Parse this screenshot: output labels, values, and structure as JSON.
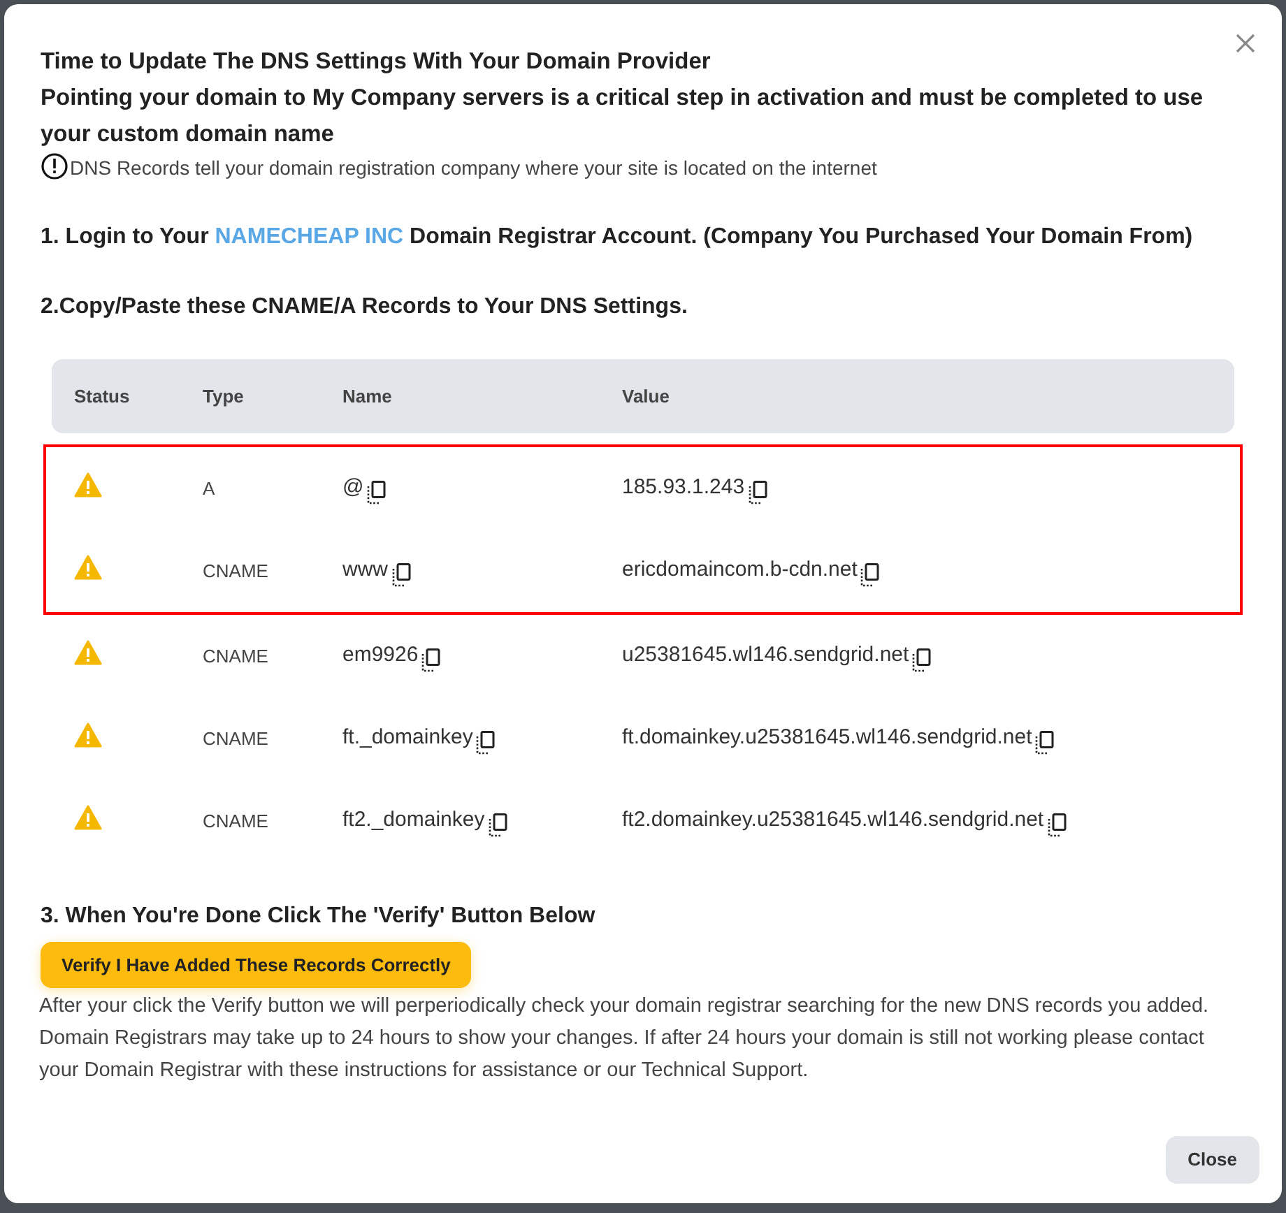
{
  "dialog": {
    "title": "Time to Update The DNS Settings With Your Domain Provider",
    "subtitle": "Pointing your domain to My Company servers is a critical step in activation and must be completed to use your custom domain name",
    "note": "DNS Records tell your domain registration company where your site is located on the internet"
  },
  "step1": {
    "prefix": "1. Login to Your",
    "registrar": "NAMECHEAP INC",
    "suffix": "Domain Registrar Account. (Company You Purchased Your Domain From)"
  },
  "step2": "2.Copy/Paste these CNAME/A Records to Your DNS Settings.",
  "table": {
    "columns": [
      "Status",
      "Type",
      "Name",
      "Value"
    ],
    "rows": [
      {
        "kind": "warning",
        "type": "A",
        "name": "@",
        "value": "185.93.1.243",
        "highlighted": true
      },
      {
        "kind": "warning",
        "type": "CNAME",
        "name": "www",
        "value": "ericdomaincom.b-cdn.net",
        "highlighted": true
      },
      {
        "kind": "warning",
        "type": "CNAME",
        "name": "em9926",
        "value": "u25381645.wl146.sendgrid.net",
        "highlighted": false
      },
      {
        "kind": "warning",
        "type": "CNAME",
        "name": "ft._domainkey",
        "value": "ft.domainkey.u25381645.wl146.sendgrid.net",
        "highlighted": false
      },
      {
        "kind": "warning",
        "type": "CNAME",
        "name": "ft2._domainkey",
        "value": "ft2.domainkey.u25381645.wl146.sendgrid.net",
        "highlighted": false
      }
    ]
  },
  "step3": "3. When You're Done Click The 'Verify' Button Below",
  "verify_button": "Verify I Have Added These Records Correctly",
  "info": "After your click the Verify button we will perperiodically check your domain registrar searching for the new DNS records you added. Domain Registrars may take up to 24 hours to show your changes. If after 24 hours your domain is still not working please contact your Domain Registrar with these instructions for assistance or our Technical Support.",
  "close_button": "Close"
}
